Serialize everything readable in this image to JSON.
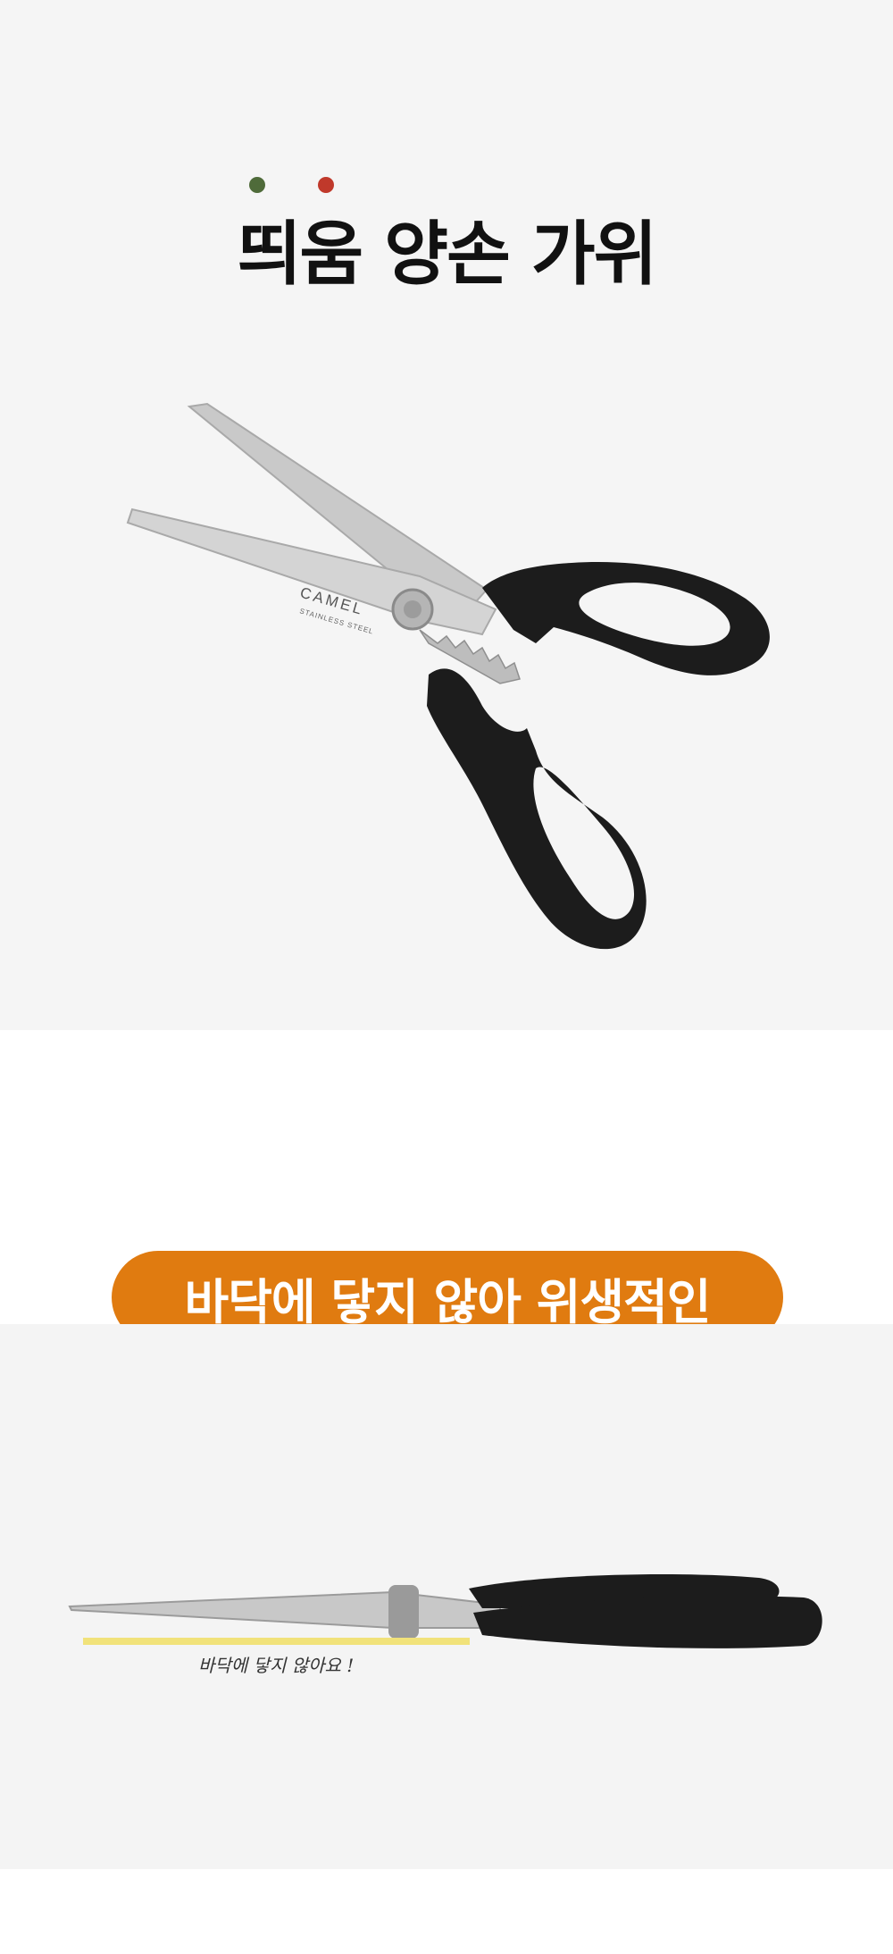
{
  "header": {
    "title": "띄움 양손 가위"
  },
  "colors": {
    "dot_green": "#4f6b3a",
    "dot_red": "#c0392b",
    "accent_orange": "#e07b10",
    "highlight_yellow": "#f1e27a",
    "handle_black": "#1c1c1c",
    "blade_steel": "#c9c9c9"
  },
  "product": {
    "blade_brand": "CAMEL",
    "blade_subtext": "STAINLESS STEEL"
  },
  "feature": {
    "headline": "바닥에 닿지 않아 위생적인",
    "note": "바닥에 닿지 않아요 !"
  }
}
